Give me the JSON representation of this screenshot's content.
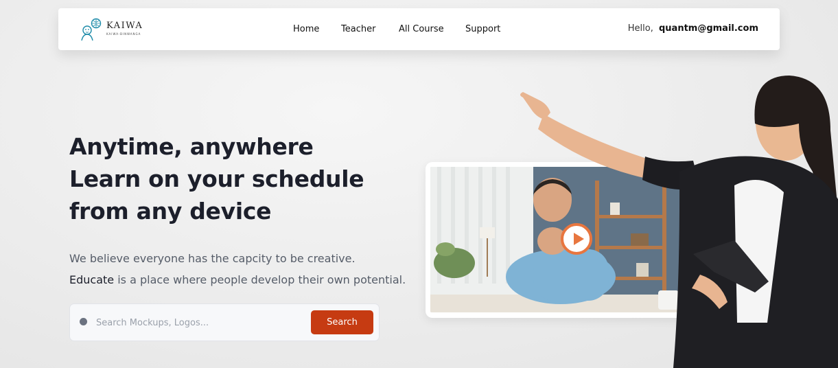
{
  "header": {
    "logo": {
      "brand": "KAIWA",
      "tagline": "KAIWA-BINWANGA"
    },
    "nav": [
      {
        "label": "Home"
      },
      {
        "label": "Teacher"
      },
      {
        "label": "All Course"
      },
      {
        "label": "Support"
      }
    ],
    "greeting": "Hello,",
    "user_email": "quantm@gmail.com"
  },
  "hero": {
    "title_lines": [
      "Anytime, anywhere",
      "Learn on your schedule",
      "from any device"
    ],
    "description_line1": "We believe everyone has the capcity to be creative.",
    "description_brand": "Educate",
    "description_line2_rest": " is a place where people develop their own potential."
  },
  "search": {
    "placeholder": "Search Mockups, Logos...",
    "value": "",
    "button_label": "Search"
  },
  "media": {
    "video_icon": "play-icon"
  },
  "colors": {
    "accent": "#c63b12",
    "play": "#e8763f",
    "text_dark": "#1c1f2b",
    "text_muted": "#555c68",
    "logo_teal": "#1b8aa8"
  }
}
